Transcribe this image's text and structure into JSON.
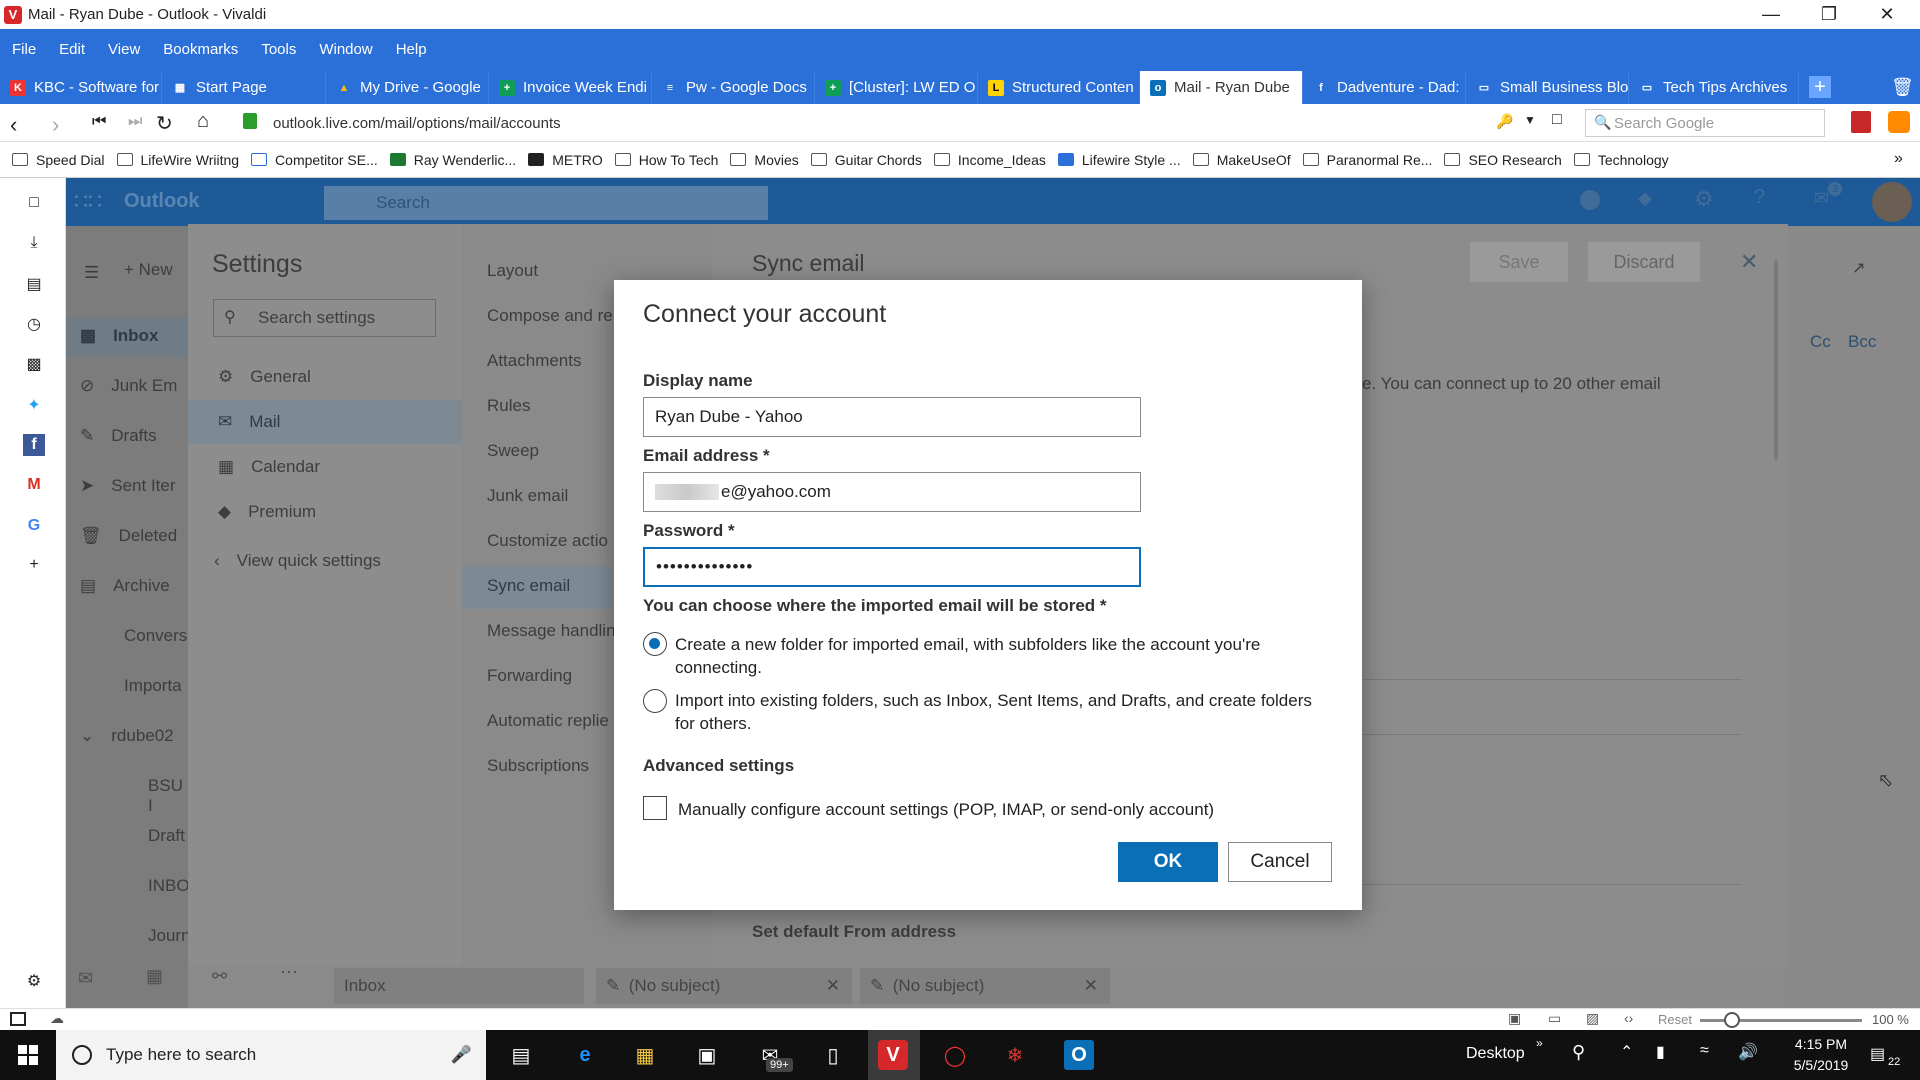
{
  "window": {
    "title": "Mail - Ryan Dube - Outlook - Vivaldi"
  },
  "menu": [
    "File",
    "Edit",
    "View",
    "Bookmarks",
    "Tools",
    "Window",
    "Help"
  ],
  "tabs": [
    {
      "label": "KBC - Software for",
      "icon": "kbc-icon",
      "color": "#2b6fd8"
    },
    {
      "label": "Start Page",
      "icon": "speed-dial-icon",
      "color": "#2b6fd8"
    },
    {
      "label": "My Drive - Google",
      "icon": "drive-icon",
      "color": "#2b6fd8"
    },
    {
      "label": "Invoice Week Endi",
      "icon": "sheets-icon",
      "color": "#2b6fd8"
    },
    {
      "label": "Pw - Google Docs",
      "icon": "docs-icon",
      "color": "#2b6fd8"
    },
    {
      "label": "[Cluster]: LW ED O",
      "icon": "sheets-icon",
      "color": "#2b6fd8"
    },
    {
      "label": "Structured Conten",
      "icon": "lifewire-icon",
      "color": "#2b6fd8"
    },
    {
      "label": "Mail - Ryan Dube",
      "icon": "outlook-icon",
      "color": "#ffffff"
    },
    {
      "label": "Dadventure - Dad:",
      "icon": "facebook-icon",
      "color": "#2b6fd8"
    },
    {
      "label": "Small Business Blo",
      "icon": "page-icon",
      "color": "#2b6fd8"
    },
    {
      "label": "Tech Tips Archives",
      "icon": "page-icon",
      "color": "#2b6fd8"
    }
  ],
  "address": {
    "url": "outlook.live.com/mail/options/mail/accounts",
    "search_placeholder": "Search Google"
  },
  "bookmarks": [
    "Speed Dial",
    "LifeWire Wriitng",
    "Competitor SE...",
    "Ray Wenderlic...",
    "METRO",
    "How To Tech",
    "Movies",
    "Guitar Chords",
    "Income_Ideas",
    "Lifewire Style ...",
    "MakeUseOf",
    "Paranormal Re...",
    "SEO Research",
    "Technology"
  ],
  "outlook": {
    "brand": "Outlook",
    "search_placeholder": "Search",
    "new_label": "New",
    "badge": "3",
    "folders": [
      "Inbox",
      "Junk Em",
      "Drafts",
      "Sent Iter",
      "Deleted",
      "Archive",
      "Convers",
      "Importa",
      "rdube02",
      "BSU I",
      "Draft",
      "INBO",
      "Journ"
    ],
    "bottom_tabs": [
      "Inbox",
      "(No subject)",
      "(No subject)"
    ],
    "cc": "Cc",
    "bcc": "Bcc"
  },
  "settings": {
    "title": "Settings",
    "search_placeholder": "Search settings",
    "nav": [
      "General",
      "Mail",
      "Calendar",
      "Premium"
    ],
    "quick": "View quick settings",
    "sub": [
      "Layout",
      "Compose and re",
      "Attachments",
      "Rules",
      "Sweep",
      "Junk email",
      "Customize actio",
      "Sync email",
      "Message handlin",
      "Forwarding",
      "Automatic replie",
      "Subscriptions"
    ],
    "pane_title": "Sync email",
    "save": "Save",
    "discard": "Discard",
    "hint": "e. You can connect up to 20 other email",
    "default_from": "Set default From address"
  },
  "dialog": {
    "title": "Connect your account",
    "display_name_label": "Display name",
    "display_name_value": "Ryan Dube - Yahoo",
    "email_label": "Email address *",
    "email_value": "e@yahoo.com",
    "password_label": "Password *",
    "password_value": "••••••••••••••",
    "store_label": "You can choose where the imported email will be stored *",
    "option1": "Create a new folder for imported email, with subfolders like the account you're connecting.",
    "option2": "Import into existing folders, such as Inbox, Sent Items, and Drafts, and create folders for others.",
    "advanced_label": "Advanced settings",
    "manual_label": "Manually configure account settings (POP, IMAP, or send-only account)",
    "ok": "OK",
    "cancel": "Cancel",
    "accent": "#0a6fb7"
  },
  "statusbar": {
    "reset": "Reset",
    "zoom": "100 %"
  },
  "taskbar": {
    "search_placeholder": "Type here to search",
    "desktop": "Desktop",
    "time": "4:15 PM",
    "date": "5/5/2019",
    "mail_badge": "99+",
    "notif_count": "22"
  }
}
